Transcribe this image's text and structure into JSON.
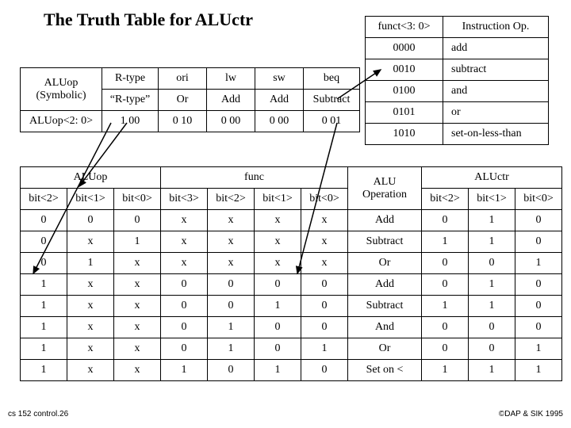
{
  "title": "The Truth Table for ALUctr",
  "funct_table": {
    "header": [
      "funct<3: 0>",
      "Instruction Op."
    ],
    "rows": [
      [
        "0000",
        "add"
      ],
      [
        "0010",
        "subtract"
      ],
      [
        "0100",
        "and"
      ],
      [
        "0101",
        "or"
      ],
      [
        "1010",
        "set-on-less-than"
      ]
    ]
  },
  "small_table": {
    "col0": [
      "ALUop",
      "(Symbolic)",
      "ALUop<2: 0>"
    ],
    "cols": [
      [
        "R-type",
        "“R-type”",
        "1 00"
      ],
      [
        "ori",
        "Or",
        "0 10"
      ],
      [
        "lw",
        "Add",
        "0 00"
      ],
      [
        "sw",
        "Add",
        "0 00"
      ],
      [
        "beq",
        "Subtract",
        "0 01"
      ]
    ]
  },
  "big_table": {
    "group_headers": [
      "ALUop",
      "func",
      "ALU Operation",
      "ALUctr"
    ],
    "sub_headers": [
      "bit<2>",
      "bit<1>",
      "bit<0>",
      "bit<3>",
      "bit<2>",
      "bit<1>",
      "bit<0>",
      "",
      "bit<2>",
      "bit<1>",
      "bit<0>"
    ],
    "rows": [
      [
        "0",
        "0",
        "0",
        "x",
        "x",
        "x",
        "x",
        "Add",
        "0",
        "1",
        "0"
      ],
      [
        "0",
        "x",
        "1",
        "x",
        "x",
        "x",
        "x",
        "Subtract",
        "1",
        "1",
        "0"
      ],
      [
        "0",
        "1",
        "x",
        "x",
        "x",
        "x",
        "x",
        "Or",
        "0",
        "0",
        "1"
      ],
      [
        "1",
        "x",
        "x",
        "0",
        "0",
        "0",
        "0",
        "Add",
        "0",
        "1",
        "0"
      ],
      [
        "1",
        "x",
        "x",
        "0",
        "0",
        "1",
        "0",
        "Subtract",
        "1",
        "1",
        "0"
      ],
      [
        "1",
        "x",
        "x",
        "0",
        "1",
        "0",
        "0",
        "And",
        "0",
        "0",
        "0"
      ],
      [
        "1",
        "x",
        "x",
        "0",
        "1",
        "0",
        "1",
        "Or",
        "0",
        "0",
        "1"
      ],
      [
        "1",
        "x",
        "x",
        "1",
        "0",
        "1",
        "0",
        "Set on <",
        "1",
        "1",
        "1"
      ]
    ]
  },
  "footer": {
    "left": "cs 152  control.26",
    "right": "©DAP & SIK 1995"
  }
}
